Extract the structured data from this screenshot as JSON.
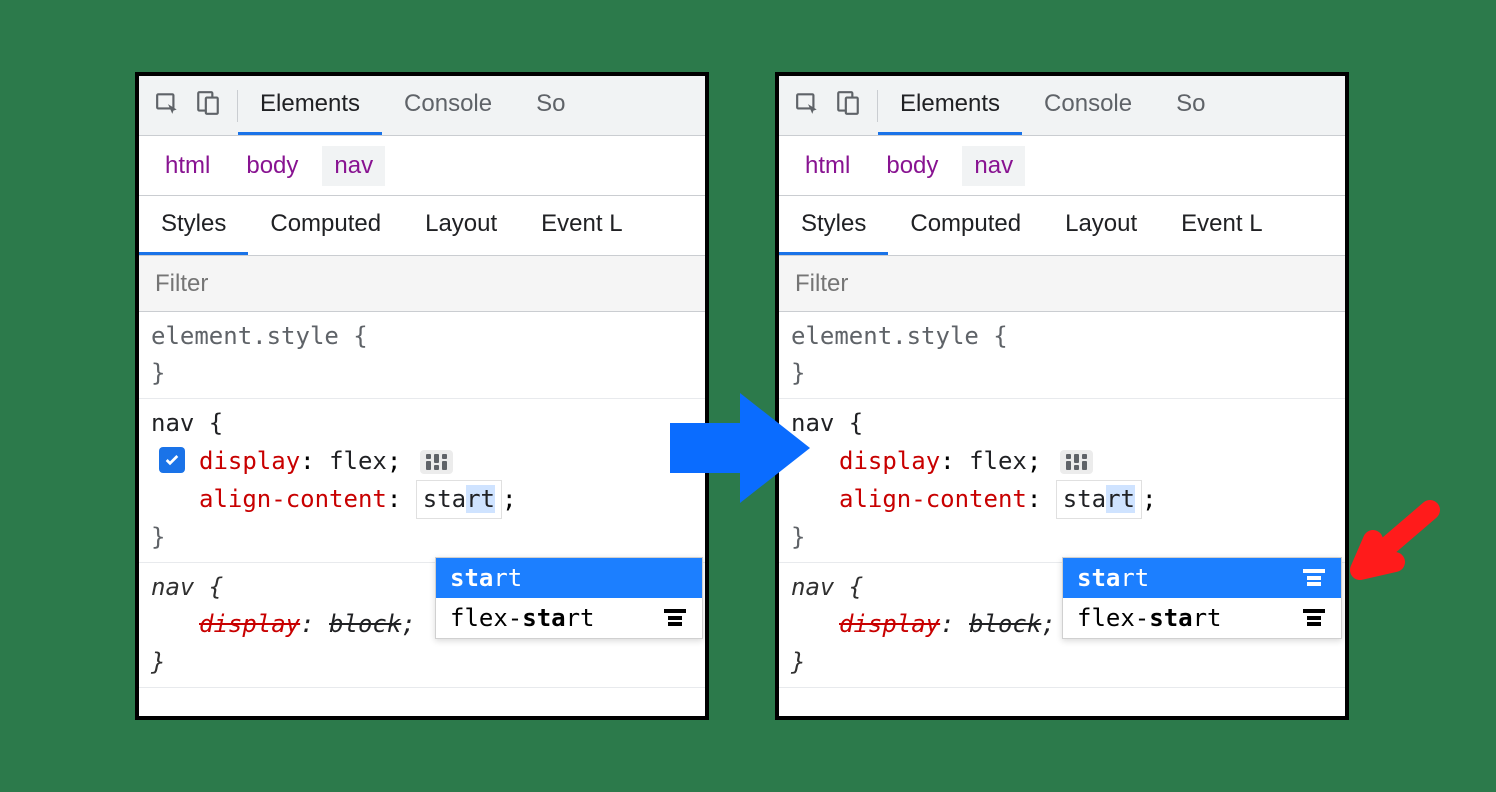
{
  "tabs": {
    "elements": "Elements",
    "console": "Console",
    "sources_cut": "So"
  },
  "breadcrumbs": {
    "html": "html",
    "body": "body",
    "nav": "nav"
  },
  "subtabs": {
    "styles": "Styles",
    "computed": "Computed",
    "layout": "Layout",
    "event_cut": "Event L"
  },
  "filter": {
    "placeholder": "Filter"
  },
  "rules": {
    "element_style_open": "element.style {",
    "brace_close": "}",
    "nav_open": "nav {",
    "display_prop": "display",
    "display_val": "flex",
    "align_prop": "align-content",
    "align_boxed_prefix": "sta",
    "align_boxed_suffix": "rt",
    "align_semi": ";",
    "nav_open_italic": "nav {",
    "display_block_prop": "display",
    "display_block_val": "block",
    "semi": ";",
    "colon": ": "
  },
  "dropdown": {
    "item1_bold": "sta",
    "item1_rest": "rt",
    "item2_pre": "flex-",
    "item2_bold": "sta",
    "item2_rest": "rt"
  }
}
